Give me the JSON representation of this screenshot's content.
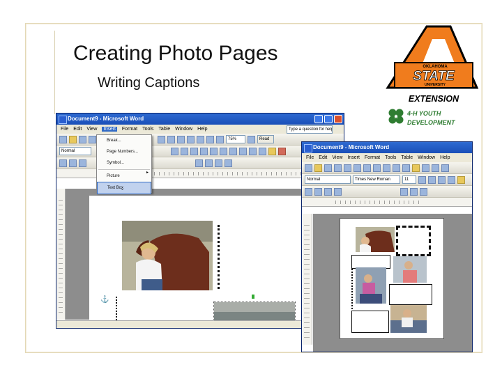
{
  "slide": {
    "title": "Creating Photo Pages",
    "subtitle": "Writing Captions"
  },
  "logo": {
    "line1": "OKLAHOMA",
    "line2": "STATE",
    "line3": "UNIVERSITY",
    "extension": "EXTENSION",
    "youth1": "4-H YOUTH",
    "youth2": "DEVELOPMENT",
    "colors": {
      "orange": "#f07c1d",
      "black": "#000000",
      "green": "#2f7d32"
    }
  },
  "word_back": {
    "title": "Document9 - Microsoft Word",
    "menus": [
      "File",
      "Edit",
      "View",
      "Insert",
      "Format",
      "Tools",
      "Table",
      "Window",
      "Help"
    ],
    "style_box": "Normal",
    "zoom": "75%",
    "read_label": "Read",
    "help_placeholder": "Type a question for help",
    "insert_menu": {
      "items": [
        "Break...",
        "Page Numbers...",
        "Symbol...",
        "Picture",
        "Text Box"
      ],
      "highlighted": "Text Box"
    }
  },
  "word_front": {
    "title": "Document9 - Microsoft Word",
    "menus": [
      "File",
      "Edit",
      "View",
      "Insert",
      "Format",
      "Tools",
      "Table",
      "Window",
      "Help"
    ],
    "style_box": "Normal",
    "font_box": "Times New Roman",
    "size_box": "11"
  },
  "colors": {
    "xp_blue": "#1a4fb8",
    "xp_chrome": "#ece9d8",
    "page_gray": "#8d8d8d"
  }
}
